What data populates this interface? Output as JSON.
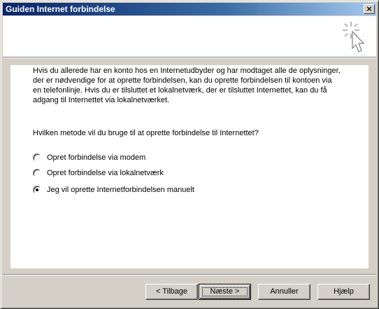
{
  "window": {
    "title": "Guiden Internet forbindelse",
    "close_glyph": "×"
  },
  "content": {
    "intro": "Hvis du allerede har en konto hos en Internetudbyder og har modtaget alle de oplysninger, der er nødvendige for at oprette forbindelsen, kan du oprette forbindelsen til kontoen via en telefonlinje. Hvis du er tilsluttet et lokalnetværk, der er tilsluttet Internettet, kan du få adgang til Internettet via lokalnetværket.",
    "question": "Hvilken metode vil du bruge til at oprette forbindelse til Internettet?",
    "options": [
      {
        "label": "Opret forbindelse via modem",
        "checked": false
      },
      {
        "label": "Opret forbindelse via lokalnetværk",
        "checked": false
      },
      {
        "label": "Jeg vil oprette Internetforbindelsen manuelt",
        "checked": true
      }
    ]
  },
  "buttons": {
    "back": "< Tilbage",
    "next": "Næste >",
    "cancel": "Annuller",
    "help": "Hjælp"
  },
  "icons": {
    "header": "wizard-cursor-icon"
  }
}
